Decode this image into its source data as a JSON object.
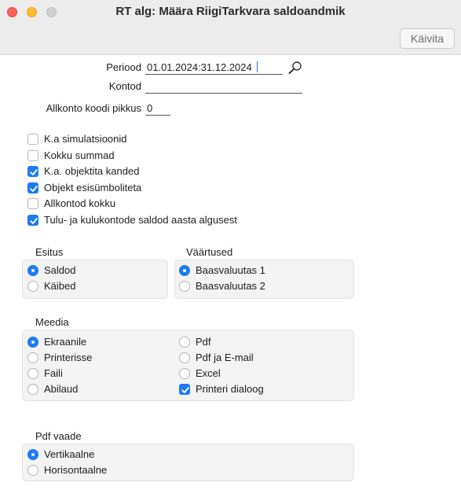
{
  "window": {
    "title": "RT alg: Määra RiigiTarkvara saldoandmik",
    "run_button": "Käivita"
  },
  "fields": {
    "period_label": "Periood",
    "period_value": "01.01.2024:31.12.2024",
    "accounts_label": "Kontod",
    "accounts_value": "",
    "subaccount_label": "Allkonto koodi pikkus",
    "subaccount_value": "0"
  },
  "options": [
    {
      "label": "K.a simulatsioonid",
      "checked": false
    },
    {
      "label": "Kokku summad",
      "checked": false
    },
    {
      "label": "K.a. objektita kanded",
      "checked": true
    },
    {
      "label": "Objekt esisümboliteta",
      "checked": true
    },
    {
      "label": "Allkontod kokku",
      "checked": false
    },
    {
      "label": "Tulu- ja kulukontode saldod aasta algusest",
      "checked": true
    }
  ],
  "esitus": {
    "title": "Esitus",
    "items": [
      {
        "label": "Saldod",
        "selected": true
      },
      {
        "label": "Käibed",
        "selected": false
      }
    ]
  },
  "vaartused": {
    "title": "Väärtused",
    "items": [
      {
        "label": "Baasvaluutas 1",
        "selected": true
      },
      {
        "label": "Baasvaluutas 2",
        "selected": false
      }
    ]
  },
  "meedia": {
    "title": "Meedia",
    "left": [
      {
        "label": "Ekraanile",
        "selected": true
      },
      {
        "label": "Printerisse",
        "selected": false
      },
      {
        "label": "Faili",
        "selected": false
      },
      {
        "label": "Abilaud",
        "selected": false
      }
    ],
    "right_radios": [
      {
        "label": "Pdf",
        "selected": false
      },
      {
        "label": "Pdf ja E-mail",
        "selected": false
      },
      {
        "label": "Excel",
        "selected": false
      }
    ],
    "printer_dialog": {
      "label": "Printeri dialoog",
      "checked": true
    }
  },
  "pdf_view": {
    "title": "Pdf vaade",
    "items": [
      {
        "label": "Vertikaalne",
        "selected": true
      },
      {
        "label": "Horisontaalne",
        "selected": false
      }
    ]
  },
  "colors": {
    "accent": "#1f7af6",
    "close": "#fe5f57",
    "minimize": "#febc2e"
  }
}
